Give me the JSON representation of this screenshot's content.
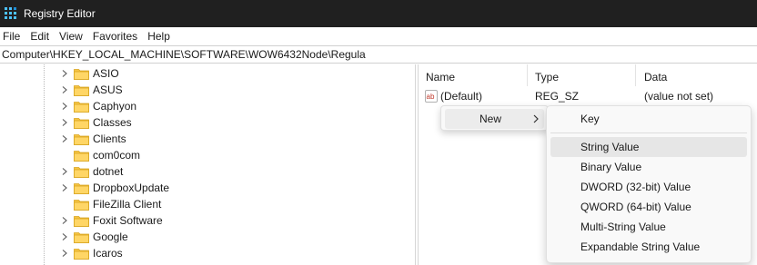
{
  "window": {
    "title": "Registry Editor",
    "titlebar_color": "#202020"
  },
  "menu": [
    "File",
    "Edit",
    "View",
    "Favorites",
    "Help"
  ],
  "address": "Computer\\HKEY_LOCAL_MACHINE\\SOFTWARE\\WOW6432Node\\Regula",
  "tree": [
    {
      "label": "ASIO",
      "expandable": true
    },
    {
      "label": "ASUS",
      "expandable": true
    },
    {
      "label": "Caphyon",
      "expandable": true
    },
    {
      "label": "Classes",
      "expandable": true
    },
    {
      "label": "Clients",
      "expandable": true
    },
    {
      "label": "com0com",
      "expandable": false
    },
    {
      "label": "dotnet",
      "expandable": true
    },
    {
      "label": "DropboxUpdate",
      "expandable": true
    },
    {
      "label": "FileZilla Client",
      "expandable": false
    },
    {
      "label": "Foxit Software",
      "expandable": true
    },
    {
      "label": "Google",
      "expandable": true
    },
    {
      "label": "Icaros",
      "expandable": true
    }
  ],
  "columns": {
    "name": "Name",
    "type": "Type",
    "data": "Data"
  },
  "values": [
    {
      "name": "(Default)",
      "type": "REG_SZ",
      "data": "(value not set)",
      "icon": "string-value-icon"
    }
  ],
  "context_menu": {
    "new_label": "New"
  },
  "submenu": {
    "key": "Key",
    "items": [
      "String Value",
      "Binary Value",
      "DWORD (32-bit) Value",
      "QWORD (64-bit) Value",
      "Multi-String Value",
      "Expandable String Value"
    ],
    "highlighted": "String Value"
  },
  "colors": {
    "folder": "#f6c443",
    "accent": "#0078d4"
  }
}
